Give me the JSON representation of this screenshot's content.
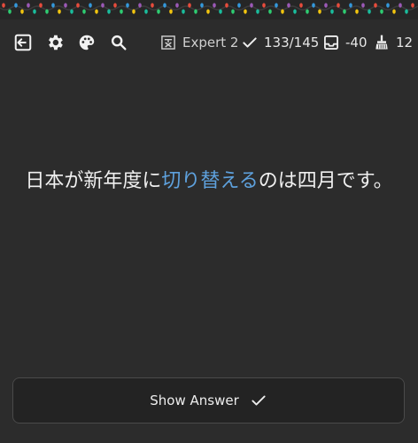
{
  "toolbar": {
    "icons": [
      {
        "name": "exit-icon"
      },
      {
        "name": "gear-icon"
      },
      {
        "name": "palette-icon"
      },
      {
        "name": "search-icon"
      }
    ],
    "deck": {
      "icon": "kanji-icon",
      "label": "Expert 2"
    },
    "reviews": {
      "icon": "check-icon",
      "value": "133/145"
    },
    "inbox": {
      "icon": "inbox-icon",
      "value": "-40"
    },
    "cleanup": {
      "icon": "broom-icon",
      "value": "12"
    }
  },
  "card": {
    "before": "日本が新年度に",
    "highlight": "切り替える",
    "after": "のは四月です。",
    "highlight_color": "#5ea1dd"
  },
  "answer_button": {
    "label": "Show Answer",
    "icon": "check-icon"
  }
}
